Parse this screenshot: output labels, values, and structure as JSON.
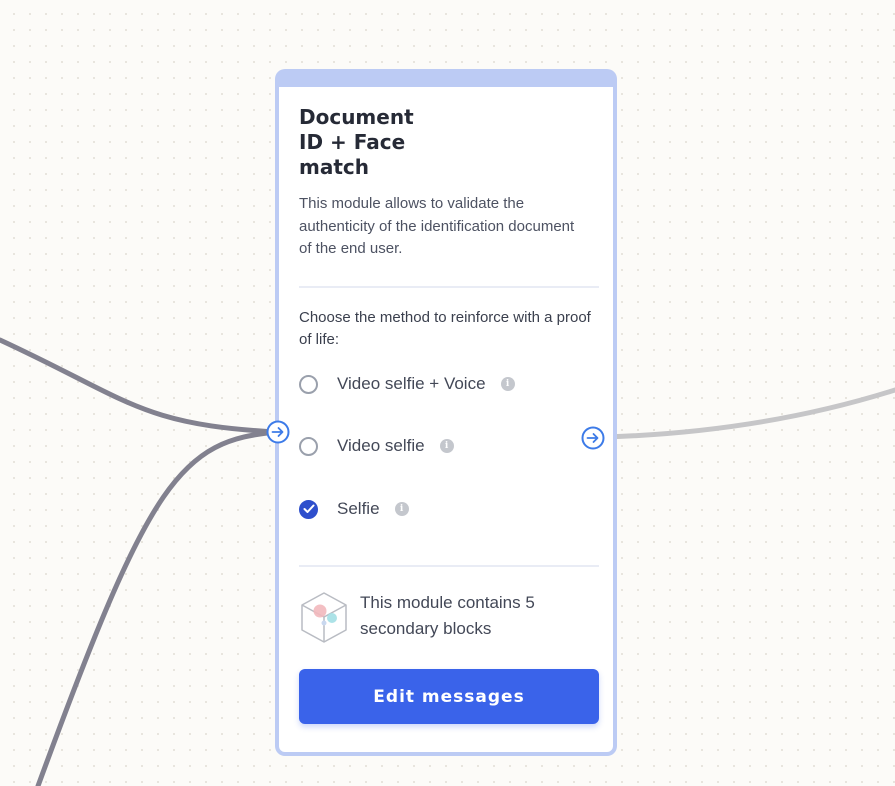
{
  "module": {
    "title": "Document ID + Face match",
    "description": "This module allows to validate the authenticity of the identification document of the end user.",
    "prompt": "Choose the method to reinforce with a proof of life:",
    "options": [
      {
        "label": "Video selfie + Voice",
        "checked": false
      },
      {
        "label": "Video selfie",
        "checked": false
      },
      {
        "label": "Selfie",
        "checked": true
      }
    ],
    "secondary_text": "This module contains 5 secondary blocks",
    "edit_button_label": "Edit messages"
  },
  "icons": {
    "input_port": "arrow-right-circle-icon",
    "output_port": "arrow-right-circle-icon",
    "info": "info-icon",
    "cube": "cube-icon",
    "checkmark": "check-icon"
  },
  "colors": {
    "card_border": "#bccbf4",
    "accent": "#3a63ea",
    "checked": "#2e4fcc",
    "port": "#3d7be8",
    "incoming_connector": "#82818f",
    "outgoing_connector": "#c6c6c8"
  }
}
